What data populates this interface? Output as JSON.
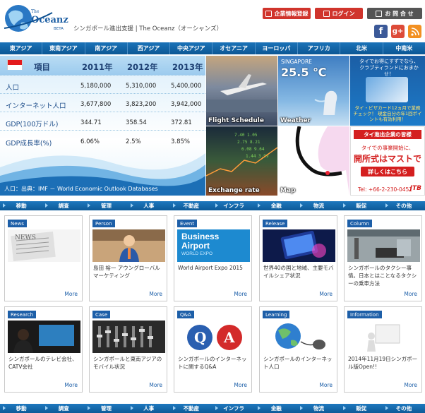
{
  "header": {
    "logo_text": "Oceanz",
    "logo_small": "The",
    "logo_beta": "BETA",
    "tagline": "シンガポール進出支援 | The Oceanz（オーシャンズ）",
    "btn_register": "企業情報登録",
    "btn_login": "ログイン",
    "btn_contact": "お 問 合 せ",
    "social": [
      "facebook-icon",
      "google-plus-icon",
      "rss-icon"
    ]
  },
  "region_nav": [
    "東アジア",
    "東南アジア",
    "南アジア",
    "西アジア",
    "中央アジア",
    "オセアニア",
    "ヨーロッパ",
    "アフリカ",
    "北米",
    "中南米"
  ],
  "stats": {
    "header": [
      "項目",
      "2011年",
      "2012年",
      "2013年"
    ],
    "rows": [
      {
        "label": "人口",
        "v": [
          "5,180,000",
          "5,310,000",
          "5,400,000"
        ]
      },
      {
        "label": "インターネット人口",
        "v": [
          "3,677,800",
          "3,823,200",
          "3,942,000"
        ]
      },
      {
        "label": "GDP(100万ドル)",
        "v": [
          "344.71",
          "358.54",
          "372.81"
        ]
      },
      {
        "label": "GDP成長率(%)",
        "v": [
          "6.06%",
          "2.5%",
          "3.85%"
        ]
      }
    ],
    "source": "人口：出典：IMF － World Economic Outlook Databases"
  },
  "tiles": {
    "flight": "Flight Schedule",
    "weather_city": "SINGAPORE",
    "weather_temp": "25.5 ℃",
    "weather": "Weather",
    "exchange": "Exchange rate",
    "map": "Map",
    "ad1_text": "タイでお得にすずでなら、クラブティランドにおまかせ！",
    "ad1_foot": "タイ・ビザカード12ヵ月で業務チェック！ 現金自分の年1回ポイントも有効利用！",
    "ad2_top": "タイ進出企業の皆様",
    "ad2_mid": "タイでの事業開始に、",
    "ad2_big": "開所式はマストです!",
    "ad2_btn": "詳しくはこちら",
    "ad2_tel": "Tel: +66-2-230-0451",
    "ad2_brand": "JTB"
  },
  "cat_nav": [
    "移動",
    "調査",
    "管理",
    "人事",
    "不動産",
    "インフラ",
    "金融",
    "物流",
    "販促",
    "その他"
  ],
  "cards_row1": [
    {
      "tag": "News",
      "title": "",
      "more": "More"
    },
    {
      "tag": "Person",
      "title": "島田 裕一 アウングローバルマーケティング",
      "more": "More"
    },
    {
      "tag": "Event",
      "title": "World Airport Expo 2015",
      "more": "More",
      "img1": "Business",
      "img2": "Airport",
      "img3": "WORLD EXPO"
    },
    {
      "tag": "Release",
      "title": "世界40の国と地域、主要モバイルシェア状況",
      "more": "More"
    },
    {
      "tag": "Column",
      "title": "シンガポールのタクシー事情。日本とはことなるタクシーの乗車方法",
      "more": "More"
    }
  ],
  "cards_row2": [
    {
      "tag": "Research",
      "title": "シンガポールのテレビ会社、CATV会社",
      "more": "More"
    },
    {
      "tag": "Case",
      "title": "シンガポールと東南アジアのモバイル状況",
      "more": "More"
    },
    {
      "tag": "Q&A",
      "title": "シンガポールのインターネットに関するQ&A",
      "more": "More",
      "q": "Q",
      "a": "A"
    },
    {
      "tag": "Learning",
      "title": "シンガポールのインターネット人口",
      "more": "More"
    },
    {
      "tag": "Information",
      "title": "2014年11月19日シンガポール版Open!!",
      "more": "More"
    }
  ]
}
